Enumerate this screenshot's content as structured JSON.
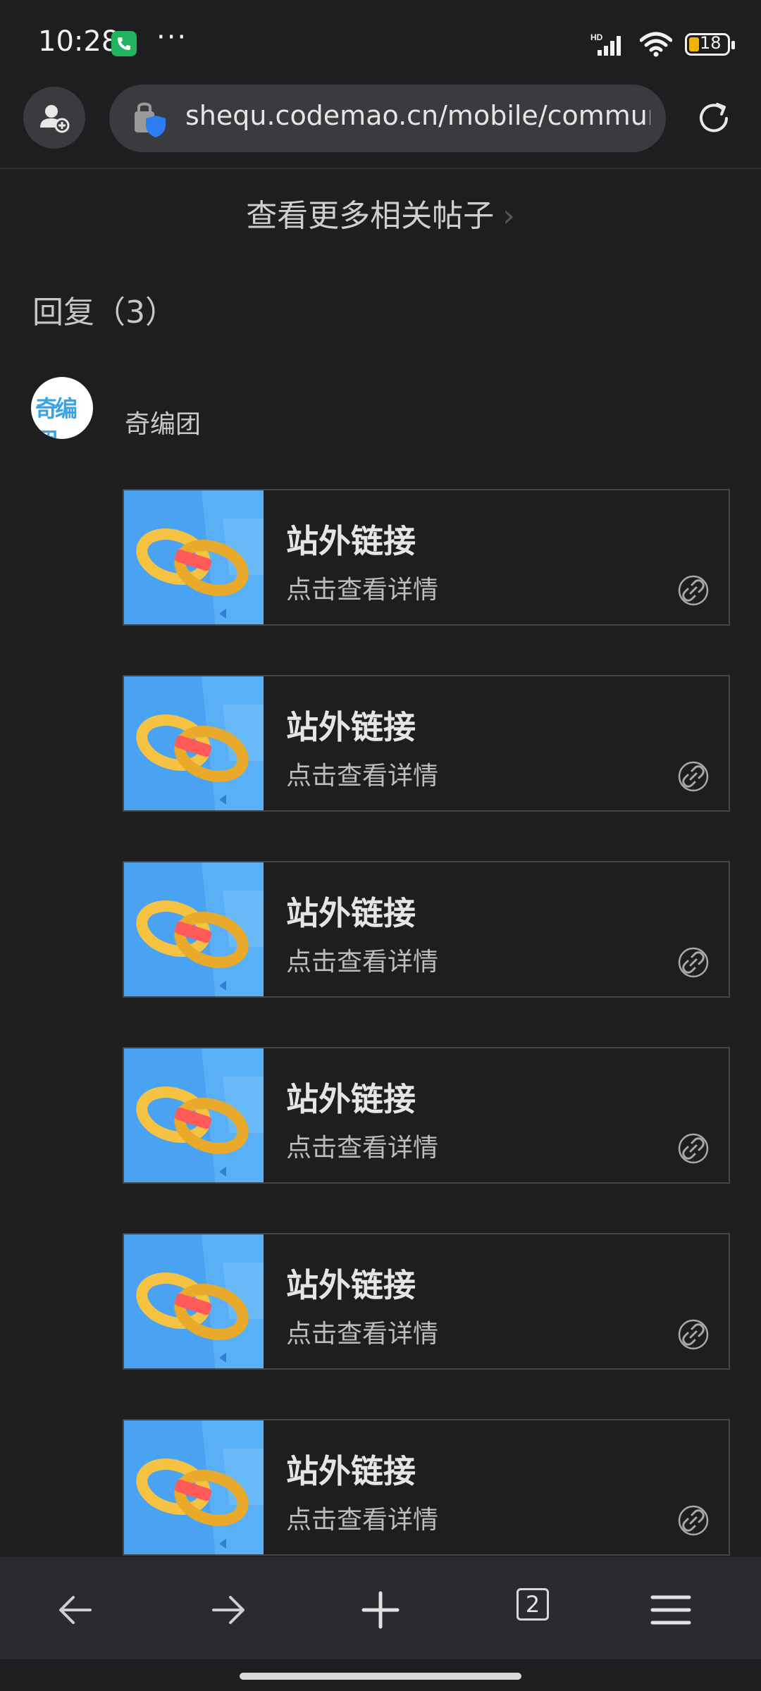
{
  "status_bar": {
    "time": "10:28",
    "more_dots": "···",
    "network_label": "HD",
    "battery_level": "18",
    "icons": [
      "phone-call-icon",
      "signal-icon",
      "wifi-icon",
      "battery-icon"
    ]
  },
  "browser": {
    "url": "shequ.codemao.cn/mobile/community",
    "icons": [
      "profile-add-icon",
      "site-security-icon",
      "reload-icon"
    ]
  },
  "page": {
    "more_posts_label": "查看更多相关帖子",
    "chevron": "›",
    "replies_header": "回复（3）",
    "author": {
      "name": "奇编团",
      "avatar_text": "奇编团"
    },
    "link_cards": [
      {
        "title": "站外链接",
        "subtitle": "点击查看详情"
      },
      {
        "title": "站外链接",
        "subtitle": "点击查看详情"
      },
      {
        "title": "站外链接",
        "subtitle": "点击查看详情"
      },
      {
        "title": "站外链接",
        "subtitle": "点击查看详情"
      },
      {
        "title": "站外链接",
        "subtitle": "点击查看详情"
      },
      {
        "title": "站外链接",
        "subtitle": "点击查看详情"
      }
    ]
  },
  "bottom_nav": {
    "tab_count": "2",
    "icons": [
      "back-arrow-icon",
      "forward-arrow-icon",
      "new-tab-plus-icon",
      "tabs-icon",
      "menu-icon"
    ]
  },
  "colors": {
    "background": "#1d1e20",
    "thumbnail_blue": "#4aa2f2",
    "chain_yellow": "#f5c242",
    "chain_red": "#ff5a5a",
    "nav_background": "#2a2b2e"
  }
}
